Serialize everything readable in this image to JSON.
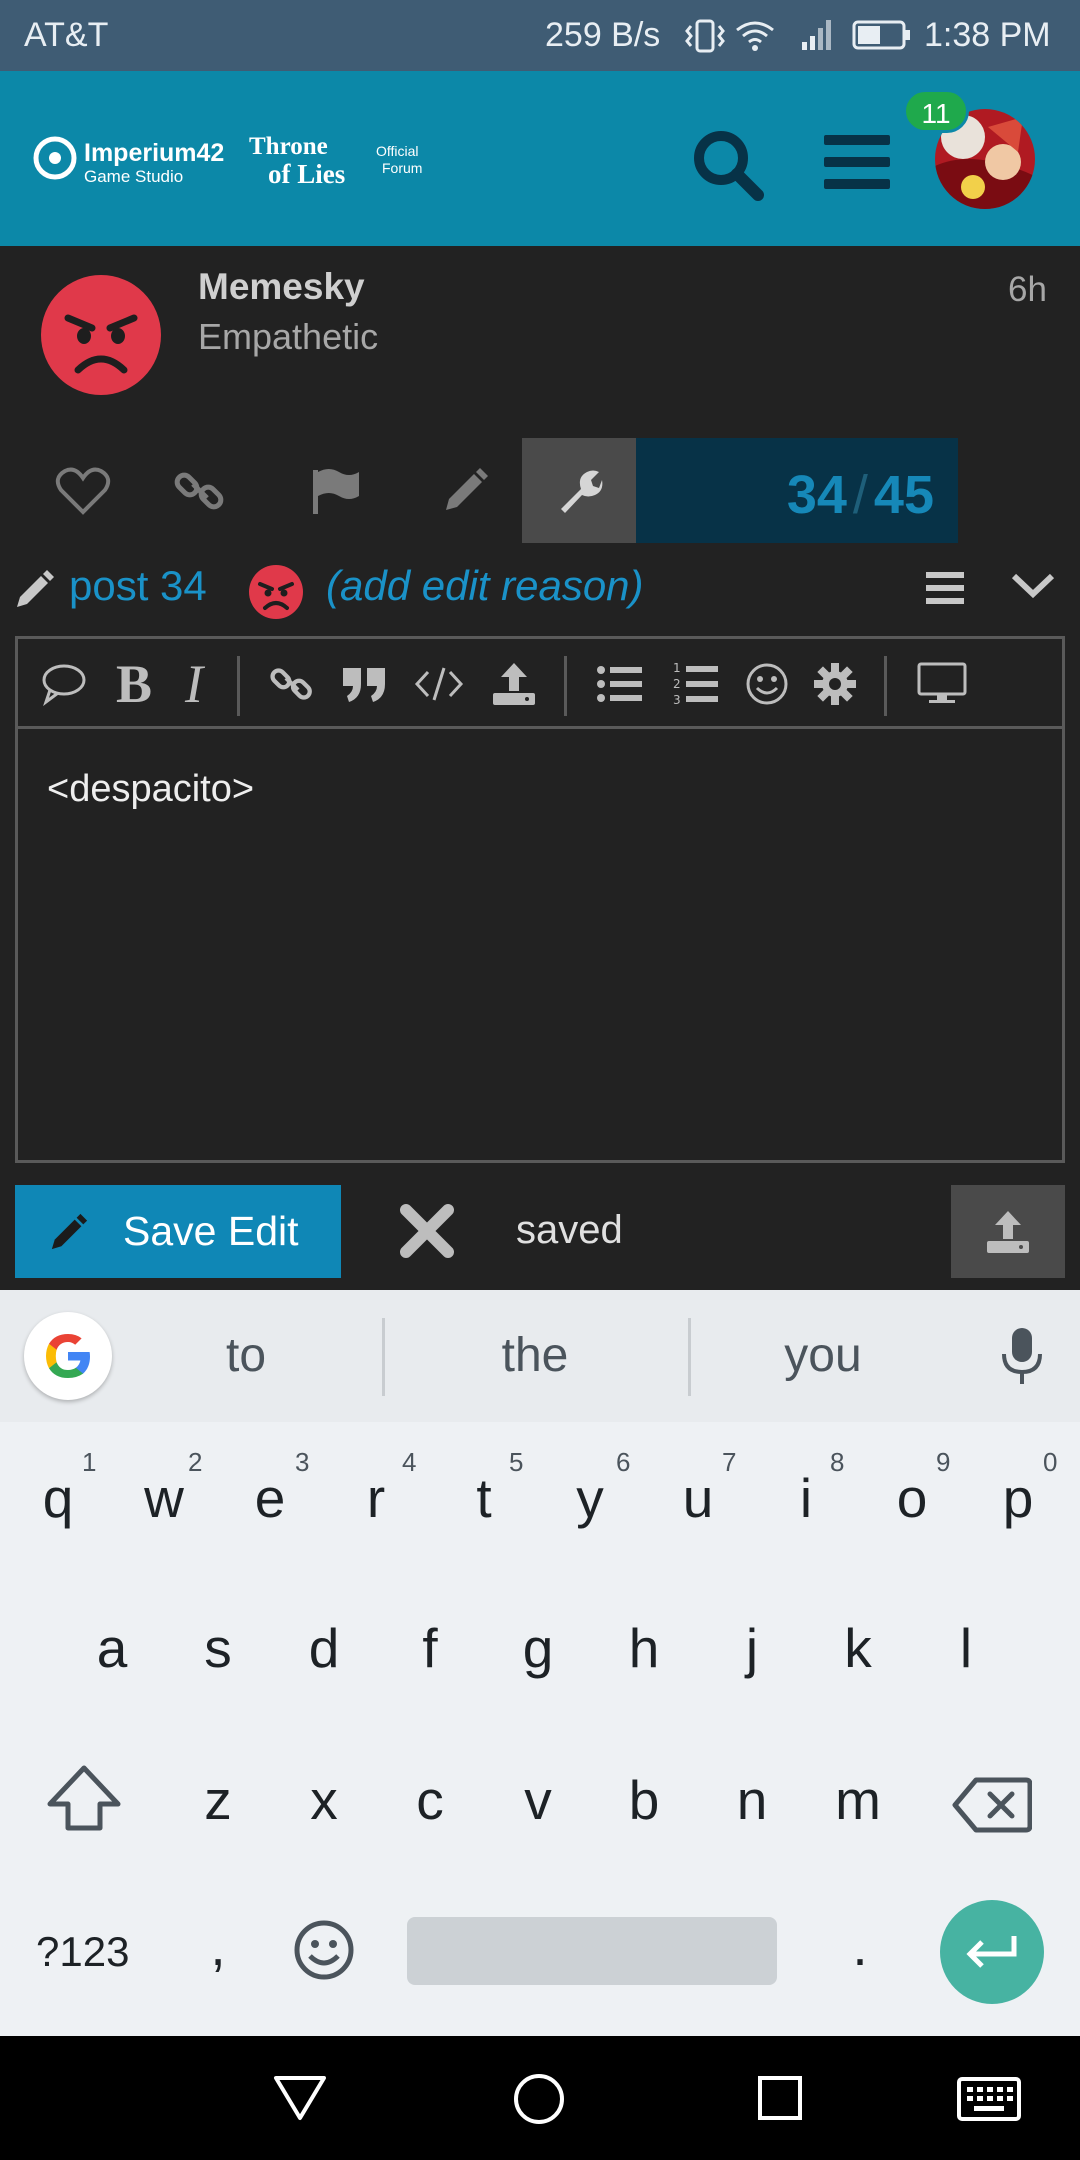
{
  "status_bar": {
    "carrier": "AT&T",
    "net_speed": "259 B/s",
    "time": "1:38 PM"
  },
  "header": {
    "brand_name": "Imperium42",
    "brand_sub": "Game Studio",
    "game_title_1": "Throne",
    "game_title_2": "of Lies",
    "forum_tag_1": "Official",
    "forum_tag_2": "Forum",
    "notification_count": "11"
  },
  "post": {
    "username": "Memesky",
    "user_title": "Empathetic",
    "age": "6h",
    "progress_current": "34",
    "progress_sep": "/",
    "progress_total": "45"
  },
  "editor": {
    "post_label": "post 34",
    "edit_reason": "(add edit reason)",
    "content": "<despacito>",
    "save_label": "Save Edit",
    "saved_status": "saved"
  },
  "keyboard": {
    "suggestions": [
      "to",
      "the",
      "you"
    ],
    "row1": [
      "q",
      "w",
      "e",
      "r",
      "t",
      "y",
      "u",
      "i",
      "o",
      "p"
    ],
    "row1_hints": [
      "1",
      "2",
      "3",
      "4",
      "5",
      "6",
      "7",
      "8",
      "9",
      "0"
    ],
    "row2": [
      "a",
      "s",
      "d",
      "f",
      "g",
      "h",
      "j",
      "k",
      "l"
    ],
    "row3": [
      "z",
      "x",
      "c",
      "v",
      "b",
      "n",
      "m"
    ],
    "symbols_key": "?123",
    "comma": ",",
    "period": "."
  },
  "colors": {
    "header_bg": "#0c88a8",
    "accent_blue": "#1a92c8",
    "save_button": "#0f87b6",
    "badge_green": "#1fa94c",
    "enter_key": "#47b3a2",
    "avatar_red": "#e0394a"
  }
}
